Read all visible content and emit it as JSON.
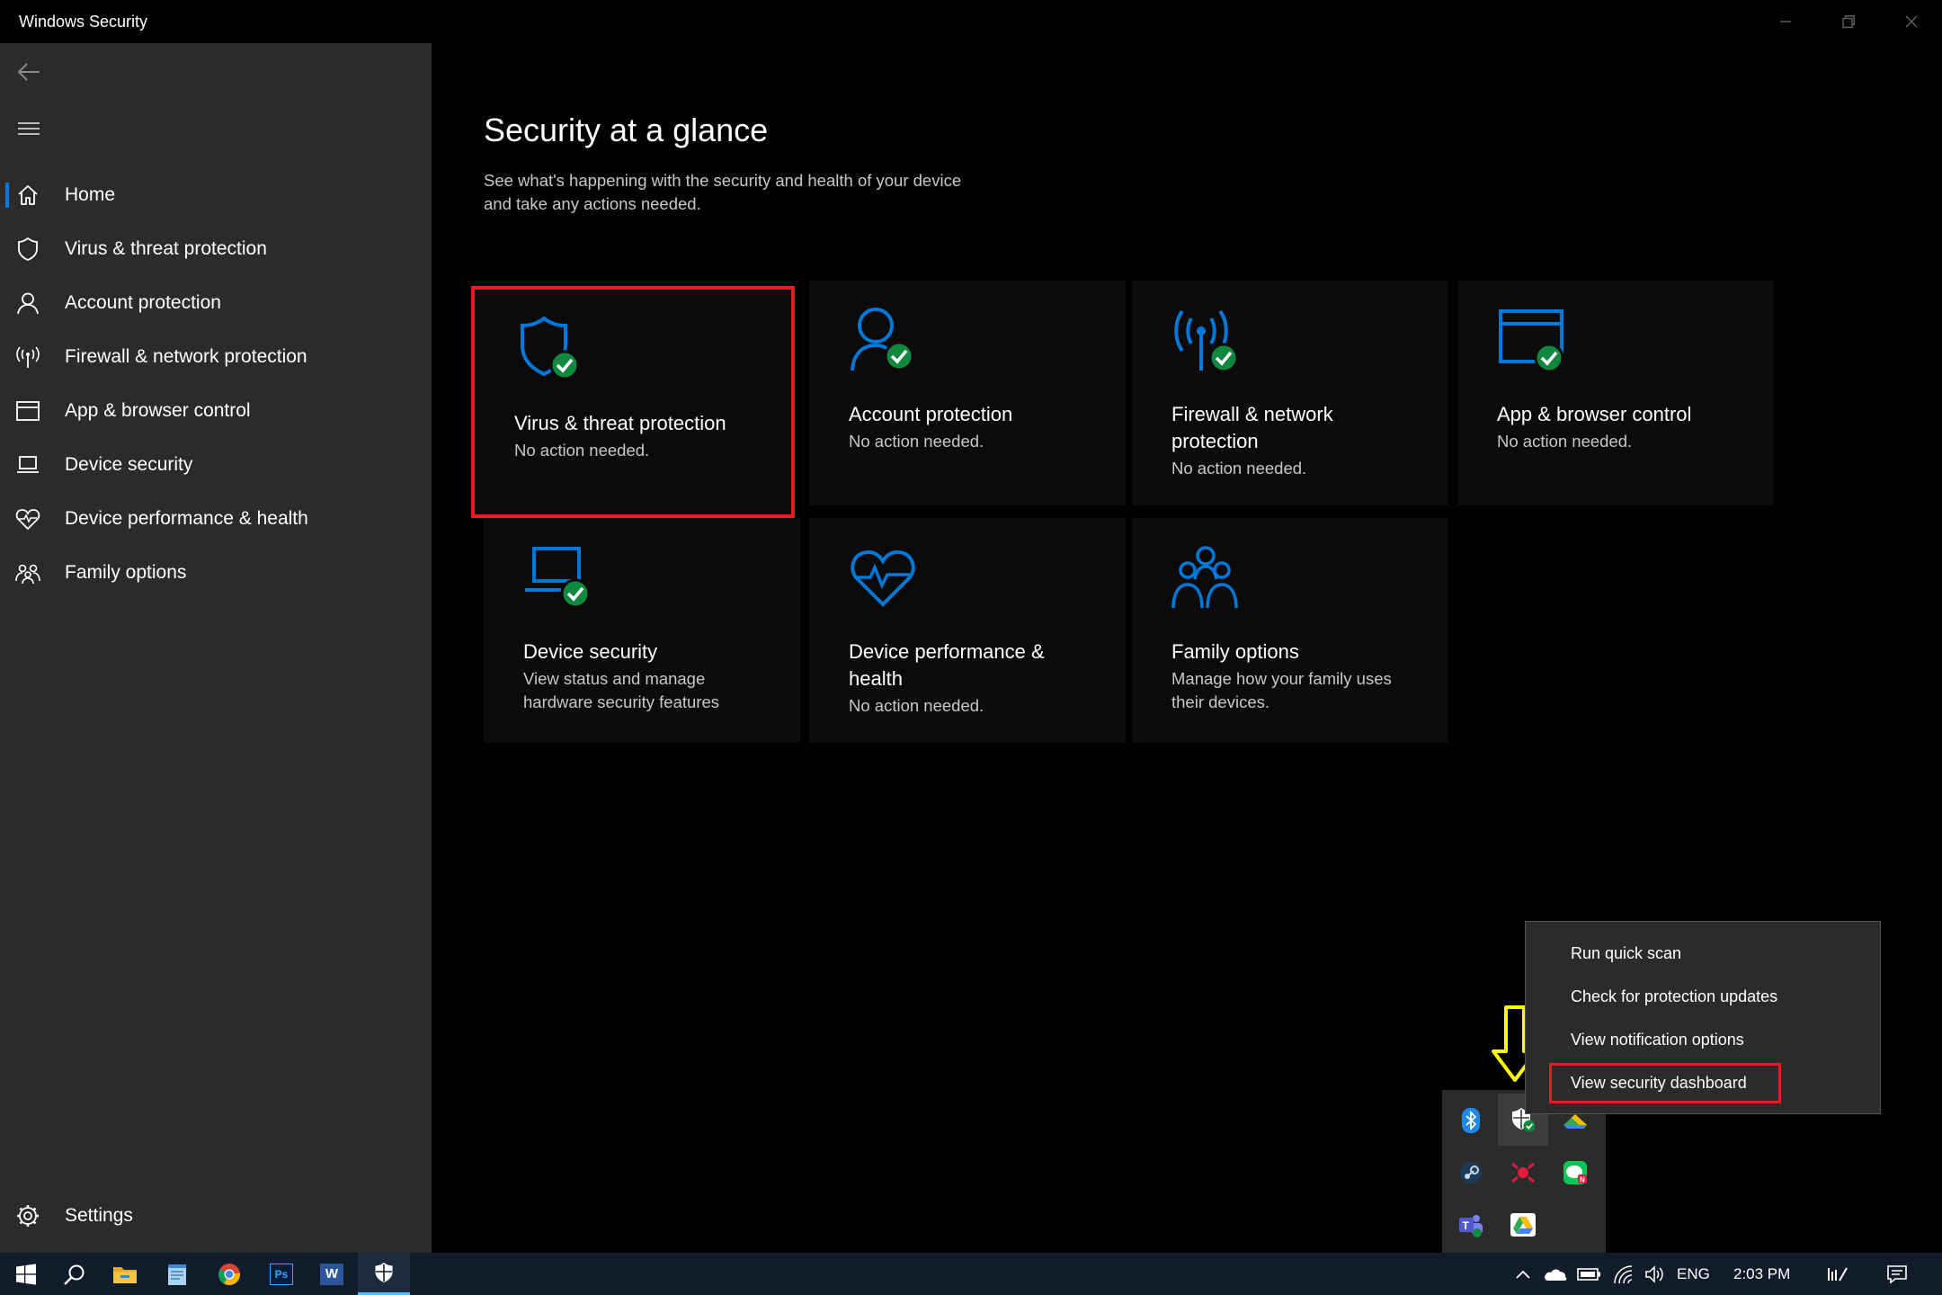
{
  "window": {
    "title": "Windows Security"
  },
  "sidebar": {
    "items": [
      {
        "label": "Home",
        "icon": "home-icon",
        "active": true
      },
      {
        "label": "Virus & threat protection",
        "icon": "shield-icon"
      },
      {
        "label": "Account protection",
        "icon": "person-icon"
      },
      {
        "label": "Firewall & network protection",
        "icon": "antenna-icon"
      },
      {
        "label": "App & browser control",
        "icon": "browser-window-icon"
      },
      {
        "label": "Device security",
        "icon": "laptop-icon"
      },
      {
        "label": "Device performance & health",
        "icon": "heart-icon"
      },
      {
        "label": "Family options",
        "icon": "family-icon"
      }
    ],
    "settings_label": "Settings"
  },
  "main": {
    "title": "Security at a glance",
    "subtitle_line1": "See what's happening with the security and health of your device",
    "subtitle_line2": "and take any actions needed.",
    "cards": [
      {
        "title": "Virus & threat protection",
        "status": "No action needed.",
        "icon": "shield-icon",
        "check": true,
        "highlighted": true
      },
      {
        "title": "Account protection",
        "status": "No action needed.",
        "icon": "person-icon",
        "check": true
      },
      {
        "title_line1": "Firewall & network",
        "title_line2": "protection",
        "status": "No action needed.",
        "icon": "antenna-icon",
        "check": true
      },
      {
        "title": "App & browser control",
        "status": "No action needed.",
        "icon": "browser-window-icon",
        "check": true
      },
      {
        "title": "Device security",
        "status_line1": "View status and manage",
        "status_line2": "hardware security features",
        "icon": "laptop-icon",
        "check": true
      },
      {
        "title_line1": "Device performance &",
        "title_line2": "health",
        "status": "No action needed.",
        "icon": "heart-icon",
        "check": false
      },
      {
        "title": "Family options",
        "status_line1": "Manage how your family uses",
        "status_line2": "their devices.",
        "icon": "family-icon",
        "check": false
      }
    ]
  },
  "context_menu": {
    "items": [
      "Run quick scan",
      "Check for protection updates",
      "View notification options",
      "View security dashboard"
    ],
    "highlighted_index": 3
  },
  "tray_overflow": {
    "icons": [
      "bluetooth-icon",
      "windows-security-icon",
      "google-drive-sync-icon",
      "steam-icon",
      "red-app-icon",
      "line-app-icon",
      "teams-icon",
      "google-drive-icon"
    ]
  },
  "taskbar": {
    "pinned": [
      "start-icon",
      "search-icon",
      "file-explorer-icon",
      "notepad-icon",
      "chrome-icon",
      "photoshop-icon",
      "word-icon",
      "windows-security-icon"
    ],
    "photoshop_label": "Ps",
    "word_label": "W",
    "language": "ENG",
    "time": "2:03 PM"
  },
  "colors": {
    "accent": "#0078d7",
    "check": "#10893e",
    "highlight": "#e31b23",
    "arrow": "#ffff00"
  }
}
